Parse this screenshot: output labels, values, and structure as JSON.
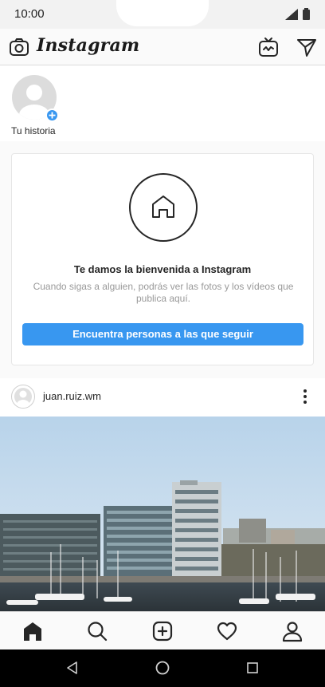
{
  "status_bar": {
    "time": "10:00"
  },
  "header": {
    "logo": "Instagram"
  },
  "stories": {
    "own_label": "Tu historia"
  },
  "welcome": {
    "title": "Te damos la bienvenida a Instagram",
    "body": "Cuando sigas a alguien, podrás ver las fotos y los vídeos que publica aquí.",
    "button_label": "Encuentra personas a las que seguir"
  },
  "post": {
    "username": "juan.ruiz.wm"
  },
  "icons": {
    "camera": "camera-icon",
    "igtv": "igtv-icon",
    "direct": "paper-plane-icon",
    "home": "home-icon",
    "search": "search-icon",
    "new_post": "plus-square-icon",
    "activity": "heart-icon",
    "profile": "person-icon",
    "more": "more-vertical-icon"
  },
  "colors": {
    "accent": "#3897f0",
    "text": "#262626",
    "muted": "#999999",
    "border": "#dbdbdb"
  }
}
